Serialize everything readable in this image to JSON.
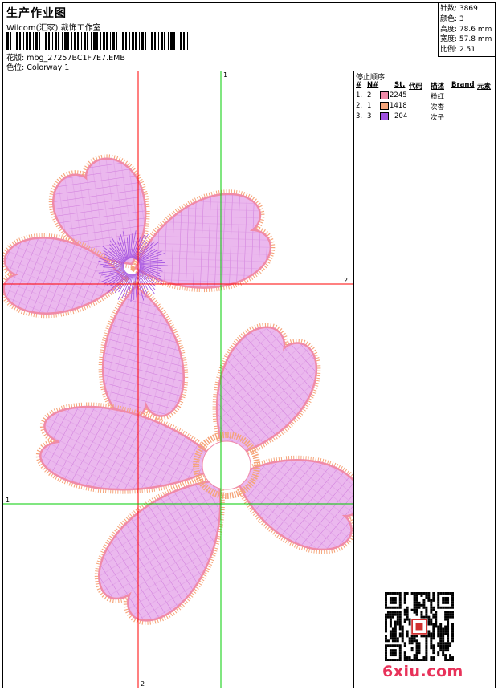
{
  "header": {
    "title": "生产作业图",
    "studio": "Wilcom(汇家) 裁饰工作室",
    "design_label": "花版:",
    "design_file": "mbg_27257BC1F7E7.EMB",
    "colorway_label": "色位:",
    "colorway": "Colorway 1"
  },
  "stats": [
    {
      "label": "针数:",
      "value": "3869"
    },
    {
      "label": "颜色:",
      "value": "3"
    },
    {
      "label": "高度:",
      "value": "78.6 mm"
    },
    {
      "label": "宽度:",
      "value": "57.8 mm"
    },
    {
      "label": "比例:",
      "value": "2.51"
    }
  ],
  "sequence": {
    "title": "停止顺序:",
    "columns": [
      "#",
      "N#",
      "St.",
      "代码",
      "描述",
      "Brand",
      "元素"
    ],
    "rows": [
      {
        "idx": "1.",
        "n": "2",
        "color": "#f08aa8",
        "stitches": "2245",
        "desc": "粉红"
      },
      {
        "idx": "2.",
        "n": "1",
        "color": "#f5a57a",
        "stitches": "1418",
        "desc": "次杏"
      },
      {
        "idx": "3.",
        "n": "3",
        "color": "#a050e0",
        "stitches": "204",
        "desc": "次子"
      }
    ]
  },
  "guides": {
    "vertical_green_label": "1",
    "horizontal_red_label": "2",
    "horizontal_green_label": "1",
    "vertical_red_label": "2"
  },
  "colors": {
    "pink": "#f08aa8",
    "apricot": "#f5a57a",
    "purple": "#a050e0",
    "fill": "#e8b0e8",
    "guide_red": "#ff0000",
    "guide_green": "#00cc00"
  },
  "watermark": {
    "logo_text": "6xiu.com"
  }
}
